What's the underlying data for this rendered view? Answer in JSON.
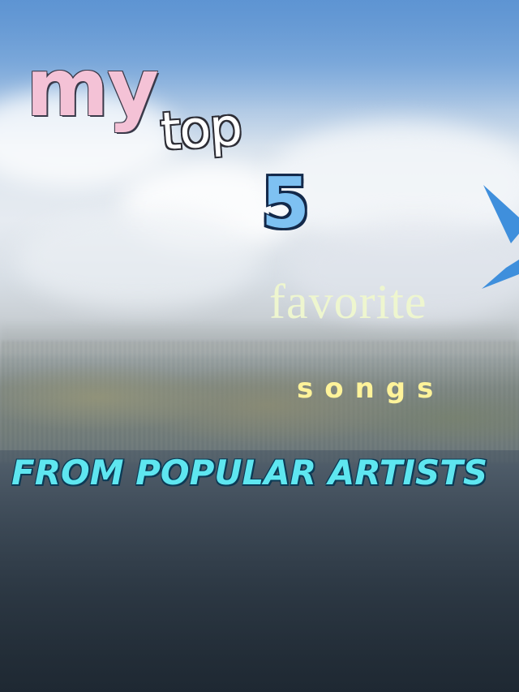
{
  "overlay": {
    "line1": "my",
    "line2": "top",
    "line3": "5",
    "line4": "favorite",
    "line5": "songs",
    "line6": "FROM POPULAR ARTISTS"
  },
  "colors": {
    "my": "#f4c2d6",
    "top": "#ffffff",
    "five": "#7ec1f2",
    "favorite": "#eef6cf",
    "songs": "#fff39a",
    "artists": "#5ee6f0",
    "wing": "#3f8fdc"
  }
}
